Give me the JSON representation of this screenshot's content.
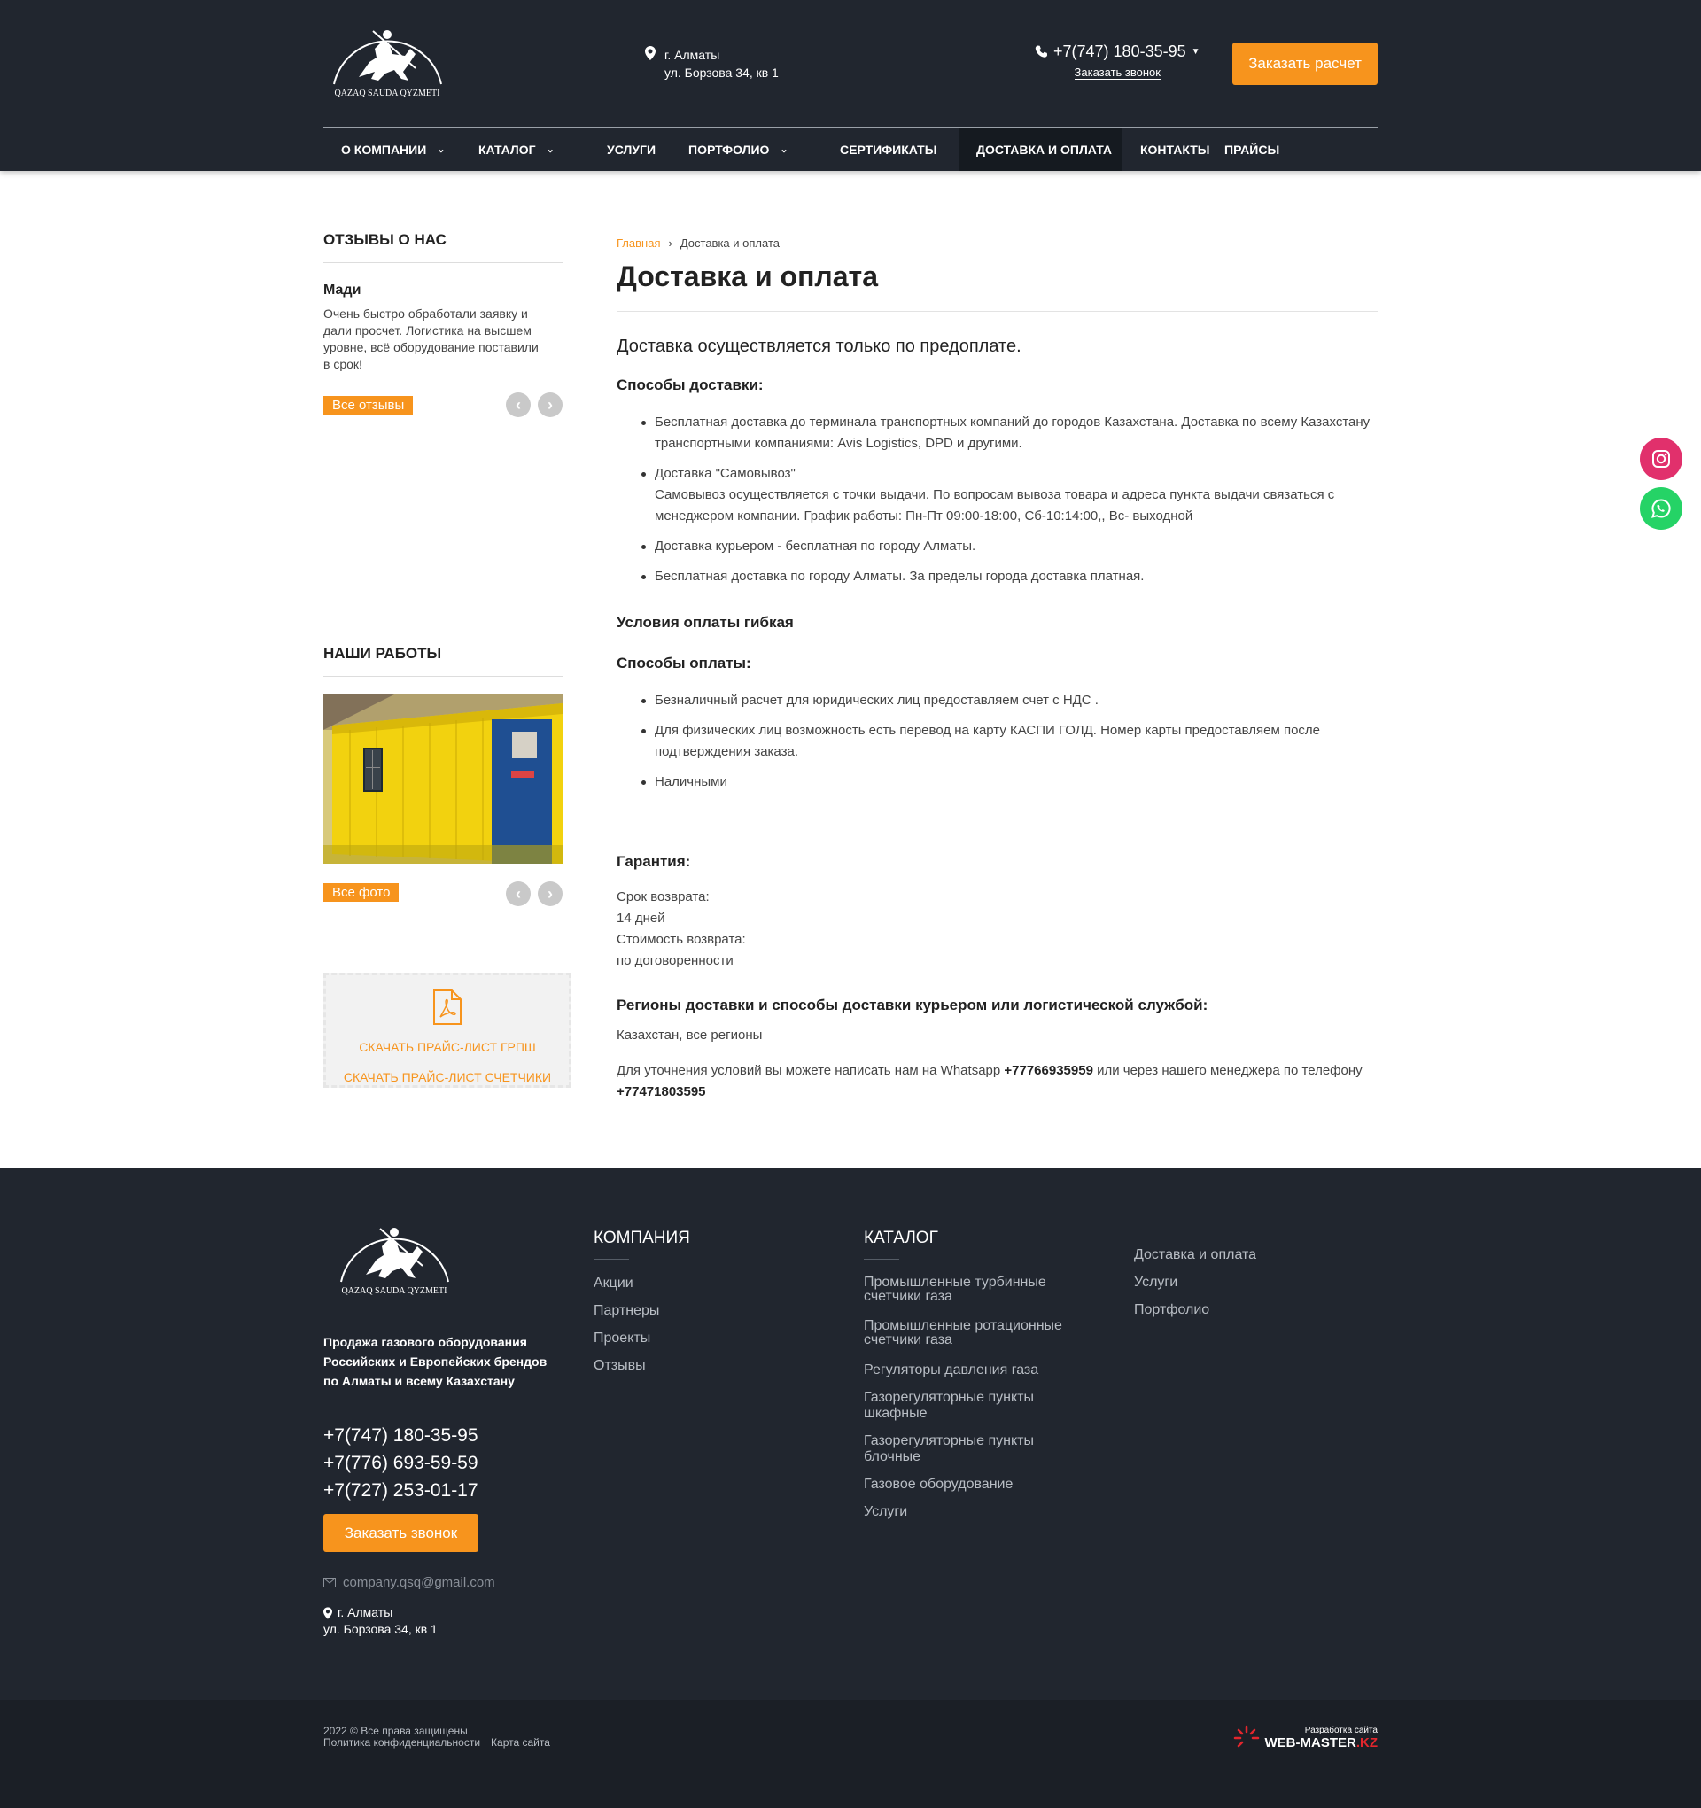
{
  "header": {
    "logo_text": "QAZAQ SAUDA QYZMETI",
    "city": "г. Алматы",
    "street": "ул. Борзова 34, кв 1",
    "phone": "+7(747) 180-35-95",
    "callback": "Заказать звонок",
    "order_btn": "Заказать расчет",
    "nav": [
      {
        "label": "О КОМПАНИИ"
      },
      {
        "label": "КАТАЛОГ"
      },
      {
        "label": "УСЛУГИ"
      },
      {
        "label": "ПОРТФОЛИО"
      },
      {
        "label": "СЕРТИФИКАТЫ"
      },
      {
        "label": "ДОСТАВКА И ОПЛАТА"
      },
      {
        "label": "КОНТАКТЫ"
      },
      {
        "label": "ПРАЙСЫ"
      }
    ]
  },
  "sidebar": {
    "reviews_title": "ОТЗЫВЫ О НАС",
    "review_name": "Мади",
    "review_text": "Очень быстро обработали заявку и дали просчет. Логистика на высшем уровне, всё оборудование поставили в срок!",
    "all_reviews": "Все отзывы",
    "works_title": "НАШИ РАБОТЫ",
    "all_photos": "Все фото",
    "price_links": [
      "СКАЧАТЬ ПРАЙС-ЛИСТ ГРПШ",
      "СКАЧАТЬ ПРАЙС-ЛИСТ СЧЕТЧИКИ"
    ]
  },
  "main": {
    "crumb_home": "Главная",
    "crumb_current": "Доставка и оплата",
    "title": "Доставка и оплата",
    "lead": "Доставка осуществляется только по предоплате.",
    "delivery_title": "Способы доставки:",
    "delivery_items": [
      "Бесплатная доставка до терминала транспортных компаний до городов Казахстана. Доставка по всему Казахстану транспортными компаниями: Avis Logistics, DPD и другими.",
      "Доставка \"Самовывоз\"",
      "Самовывоз осуществляется с точки выдачи. По вопросам вывоза товара и адреса пункта выдачи связаться с менеджером компании. График работы: Пн-Пт 09:00-18:00, Сб-10:14:00,, Вс- выходной",
      "Доставка курьером - бесплатная по городу Алматы.",
      "Бесплатная доставка по городу Алматы. За пределы города доставка платная."
    ],
    "flex_title": "Условия оплаты гибкая",
    "payment_title": "Способы оплаты:",
    "payment_items": [
      "Безналичный расчет для юридических лиц предоставляем счет с НДС .",
      "Для физических лиц возможность есть перевод на карту КАСПИ ГОЛД. Номер карты предоставляем после подтверждения заказа.",
      "Наличными"
    ],
    "guarantee_title": "Гарантия:",
    "guarantee_lines": [
      "Срок возврата:",
      "14 дней",
      "Стоимость возврата:",
      "по договоренности"
    ],
    "regions_title": "Регионы доставки и способы доставки курьером или логистической службой:",
    "regions_text": "Казахстан, все регионы",
    "contact_pre": "Для уточнения условий вы можете написать нам на Whatsapp ",
    "whatsapp": "+77766935959",
    "contact_mid": " или через нашего менеджера по телефону ",
    "manager_phone": "+77471803595"
  },
  "footer": {
    "logo_text": "QAZAQ SAUDA QYZMETI",
    "about": "Продажа газового оборудования Российских и Европейских брендов по Алматы и всему Казахстану",
    "phones": [
      "+7(747) 180-35-95",
      "+7(776) 693-59-59",
      "+7(727) 253-01-17"
    ],
    "callback_btn": "Заказать звонок",
    "email": "company.qsq@gmail.com",
    "city": "г. Алматы",
    "street": "ул. Борзова 34, кв 1",
    "company_title": "КОМПАНИЯ",
    "company_links": [
      "Акции",
      "Партнеры",
      "Проекты",
      "Отзывы"
    ],
    "catalog_title": "КАТАЛОГ",
    "catalog_links": [
      "Промышленные турбинные счетчики газа",
      "Промышленные ротационные счетчики газа",
      "Регуляторы давления газа",
      "Газорегуляторные пункты шкафные",
      "Газорегуляторные пункты блочные",
      "Газовое оборудование",
      "Услуги"
    ],
    "extra_links": [
      "Доставка и оплата",
      "Услуги",
      "Портфолио"
    ],
    "copyright": "2022 © Все права защищены",
    "privacy": "Политика конфиденциальности",
    "sitemap": "Карта сайта",
    "dev_label": "Разработка сайта",
    "dev_name": "WEB-MASTER",
    "dev_tld": ".KZ"
  },
  "colors": {
    "accent": "#f7941d",
    "dark": "#21262f"
  }
}
